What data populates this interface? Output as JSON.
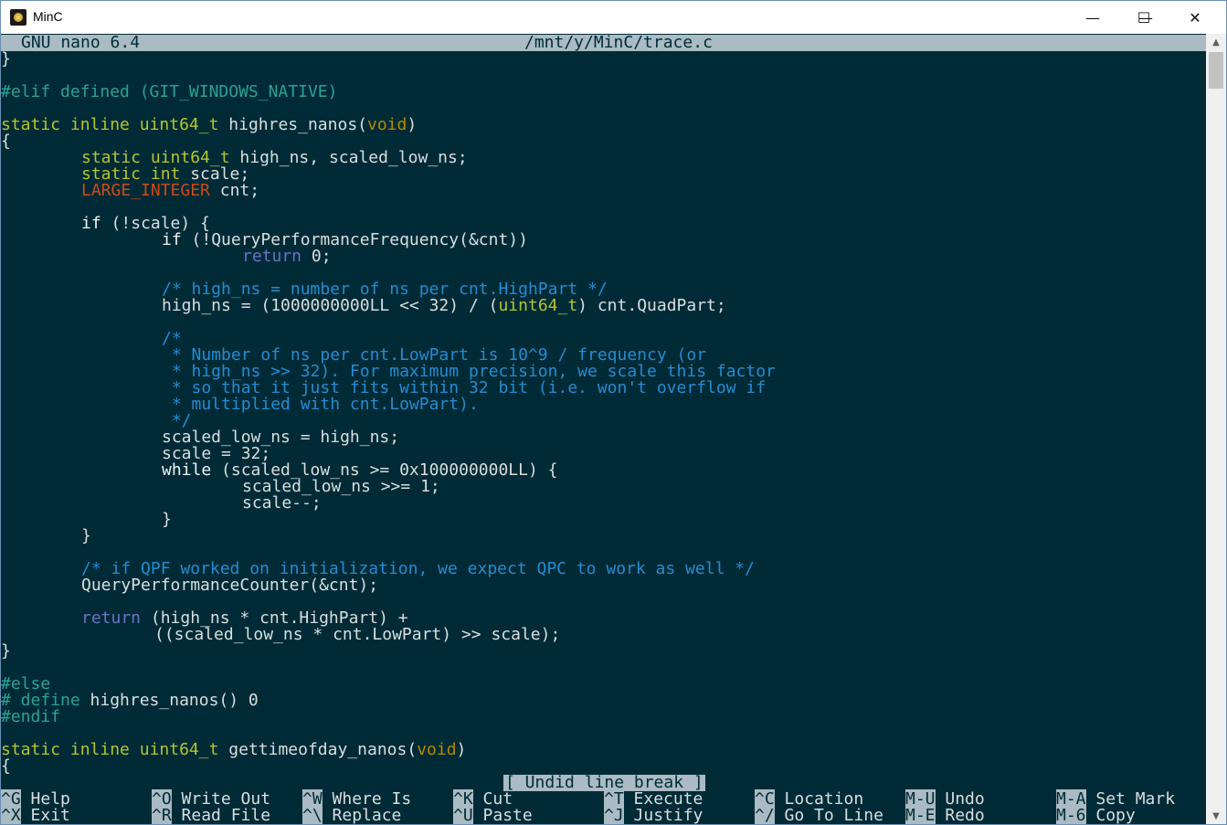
{
  "window": {
    "title": "MinC",
    "minimize": "—",
    "maximize": "☐",
    "close": "✕"
  },
  "nano": {
    "version": "GNU nano 6.4",
    "file_path": "/mnt/y/MinC/trace.c"
  },
  "code": {
    "l0": "}",
    "l1": "",
    "l2": "#elif defined (GIT_WINDOWS_NATIVE)",
    "l3": "",
    "l4_kw": "static inline",
    "l4_ty": "uint64_t",
    "l4_rest": " highres_nanos(",
    "l4_void": "void",
    "l4_end": ")",
    "l5": "{",
    "l7_kw": "static",
    "l7_ty": "uint64_t",
    "l7_rest": " high_ns, scaled_low_ns;",
    "l8_kw": "static int",
    "l8_rest": " scale;",
    "l9_li": "LARGE_INTEGER",
    "l9_rest": " cnt;",
    "l11_if": "if",
    "l11_rest": " (!scale) {",
    "l12_if": "if",
    "l12_rest": " (!QueryPerformanceFrequency(&cnt))",
    "l13_ret": "return",
    "l13_rest": " 0;",
    "l15_cm": "/* high_ns = number of ns per cnt.HighPart */",
    "l16_a": "high_ns = (1000000000LL << 32) / (",
    "l16_ty": "uint64_t",
    "l16_b": ") cnt.QuadPart;",
    "l18_cm": "/*",
    "l19_cm": " * Number of ns per cnt.LowPart is 10^9 / frequency (or",
    "l20_cm": " * high_ns >> 32). For maximum precision, we scale this factor",
    "l21_cm": " * so that it just fits within 32 bit (i.e. won't overflow if",
    "l22_cm": " * multiplied with cnt.LowPart).",
    "l23_cm": " */",
    "l24": "scaled_low_ns = high_ns;",
    "l25": "scale = 32;",
    "l26_while": "while",
    "l26_rest": " (scaled_low_ns >= 0x100000000LL) {",
    "l27": "scaled_low_ns >>= 1;",
    "l28": "scale--;",
    "l29": "}",
    "l30": "}",
    "l32_cm": "/* if QPF worked on initialization, we expect QPC to work as well */",
    "l33": "QueryPerformanceCounter(&cnt);",
    "l35_ret": "return",
    "l35_rest": " (high_ns * cnt.HighPart) +",
    "l36": "((scaled_low_ns * cnt.LowPart) >> scale);",
    "l37": "}",
    "l39": "#else",
    "l40_pp": "# define",
    "l40_rest": " highres_nanos() 0",
    "l41": "#endif",
    "l43_kw": "static inline",
    "l43_ty": "uint64_t",
    "l43_rest": " gettimeofday_nanos(",
    "l43_void": "void",
    "l43_end": ")",
    "l44": "{"
  },
  "message": "[ Undid line break ]",
  "shortcuts": [
    {
      "key": "^G",
      "label": "Help"
    },
    {
      "key": "^X",
      "label": "Exit"
    },
    {
      "key": "^O",
      "label": "Write Out"
    },
    {
      "key": "^R",
      "label": "Read File"
    },
    {
      "key": "^W",
      "label": "Where Is"
    },
    {
      "key": "^\\",
      "label": "Replace"
    },
    {
      "key": "^K",
      "label": "Cut"
    },
    {
      "key": "^U",
      "label": "Paste"
    },
    {
      "key": "^T",
      "label": "Execute"
    },
    {
      "key": "^J",
      "label": "Justify"
    },
    {
      "key": "^C",
      "label": "Location"
    },
    {
      "key": "^/",
      "label": "Go To Line"
    },
    {
      "key": "M-U",
      "label": "Undo"
    },
    {
      "key": "M-E",
      "label": "Redo"
    },
    {
      "key": "M-A",
      "label": "Set Mark"
    },
    {
      "key": "M-6",
      "label": "Copy"
    }
  ],
  "colors": {
    "background": "#002b36",
    "status_bar": "#aabbc3",
    "keyword": "#b5c42e",
    "preprocessor": "#2aa198",
    "comment": "#268bd2",
    "type": "#b58900"
  }
}
